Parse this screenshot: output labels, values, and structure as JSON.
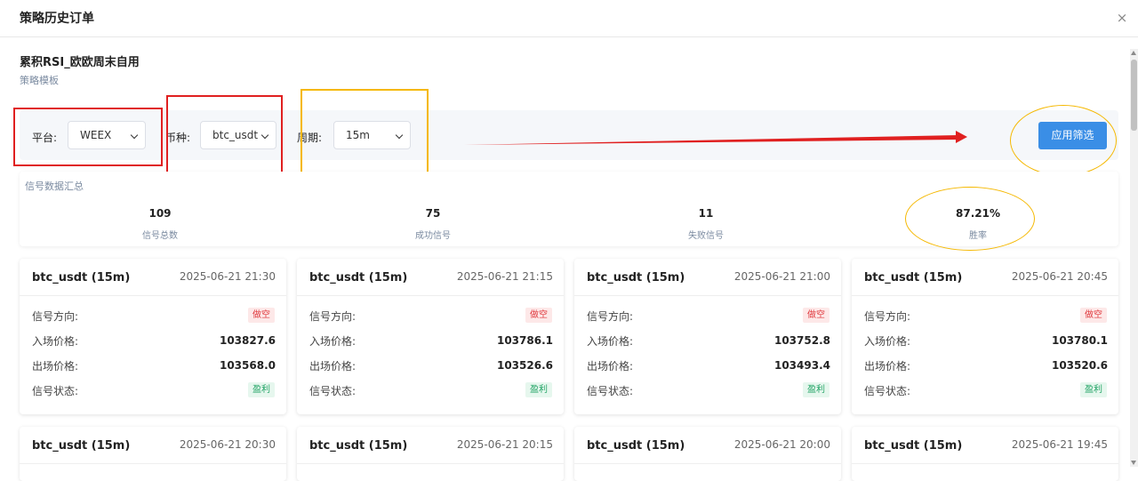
{
  "modal": {
    "title": "策略历史订单",
    "close_symbol": "×"
  },
  "strategy": {
    "name": "累积RSI_欧欧周末自用",
    "subtitle": "策略模板"
  },
  "filters": {
    "platform_label": "平台:",
    "platform_value": "WEEX",
    "symbol_label": "币种:",
    "symbol_value": "btc_usdt",
    "period_label": "周期:",
    "period_value": "15m",
    "apply_label": "应用筛选"
  },
  "summary": {
    "title": "信号数据汇总",
    "stats": [
      {
        "value": "109",
        "label": "信号总数"
      },
      {
        "value": "75",
        "label": "成功信号"
      },
      {
        "value": "11",
        "label": "失败信号"
      },
      {
        "value": "87.21%",
        "label": "胜率"
      }
    ]
  },
  "row_labels": {
    "direction": "信号方向:",
    "entry": "入场价格:",
    "exit": "出场价格:",
    "status": "信号状态:"
  },
  "cards": [
    {
      "symbol": "btc_usdt (15m)",
      "time": "2025-06-21 21:30",
      "direction": "做空",
      "entry": "103827.6",
      "exit": "103568.0",
      "status": "盈利"
    },
    {
      "symbol": "btc_usdt (15m)",
      "time": "2025-06-21 21:15",
      "direction": "做空",
      "entry": "103786.1",
      "exit": "103526.6",
      "status": "盈利"
    },
    {
      "symbol": "btc_usdt (15m)",
      "time": "2025-06-21 21:00",
      "direction": "做空",
      "entry": "103752.8",
      "exit": "103493.4",
      "status": "盈利"
    },
    {
      "symbol": "btc_usdt (15m)",
      "time": "2025-06-21 20:45",
      "direction": "做空",
      "entry": "103780.1",
      "exit": "103520.6",
      "status": "盈利"
    },
    {
      "symbol": "btc_usdt (15m)",
      "time": "2025-06-21 20:30"
    },
    {
      "symbol": "btc_usdt (15m)",
      "time": "2025-06-21 20:15"
    },
    {
      "symbol": "btc_usdt (15m)",
      "time": "2025-06-21 20:00"
    },
    {
      "symbol": "btc_usdt (15m)",
      "time": "2025-06-21 19:45"
    }
  ],
  "colors": {
    "accent": "#3a8ee6",
    "short_badge": "#e0393e",
    "win_badge": "#21a365",
    "annotation_red": "#e02020",
    "annotation_yellow": "#f5b800"
  }
}
